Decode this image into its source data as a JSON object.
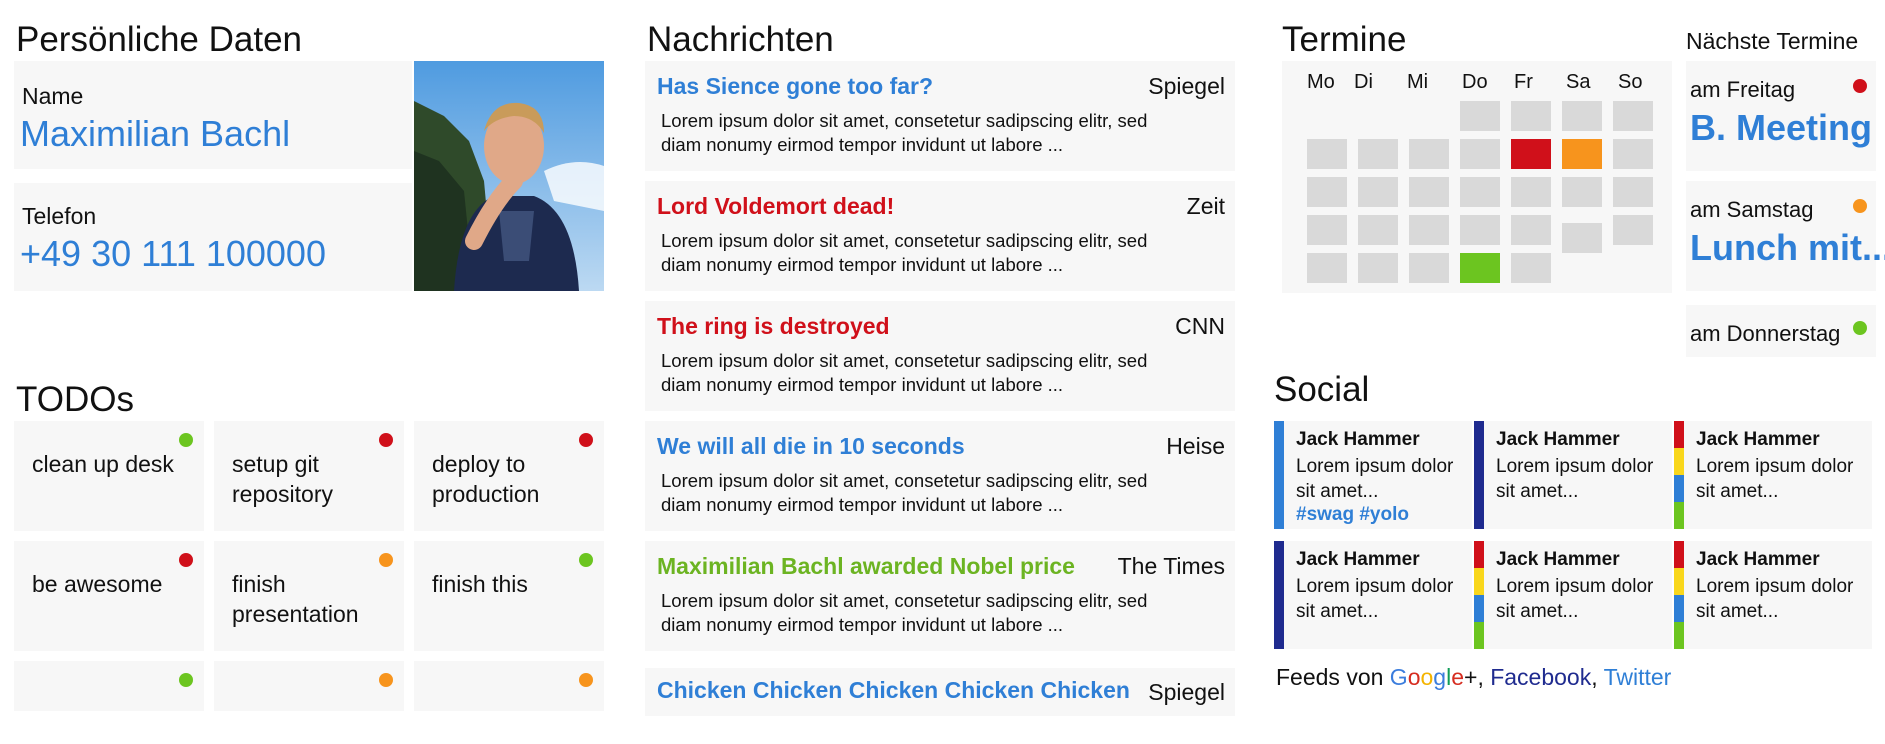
{
  "personal": {
    "title": "Persönliche Daten",
    "name_label": "Name",
    "name_value": "Maximilian Bachl",
    "phone_label": "Telefon",
    "phone_value": "+49 30 111 100000"
  },
  "todos": {
    "title": "TODOs",
    "items": [
      {
        "text": "clean up desk",
        "status": "green"
      },
      {
        "text": "setup git repository",
        "status": "red"
      },
      {
        "text": "deploy to production",
        "status": "red"
      },
      {
        "text": "be awesome",
        "status": "red"
      },
      {
        "text": "finish presentation",
        "status": "orange"
      },
      {
        "text": "finish this",
        "status": "green"
      },
      {
        "text": "",
        "status": "green"
      },
      {
        "text": "",
        "status": "orange"
      },
      {
        "text": "",
        "status": "orange"
      }
    ]
  },
  "news": {
    "title": "Nachrichten",
    "items": [
      {
        "headline": "Has Sience gone too far?",
        "source": "Spiegel",
        "body": "Lorem ipsum dolor sit amet, consetetur sadipscing elitr, sed diam nonumy eirmod tempor invidunt ut labore ...",
        "color": "#2f7fd6"
      },
      {
        "headline": "Lord Voldemort dead!",
        "source": "Zeit",
        "body": "Lorem ipsum dolor sit amet, consetetur sadipscing elitr, sed diam nonumy eirmod tempor invidunt ut labore ...",
        "color": "#d0101a"
      },
      {
        "headline": "The ring is destroyed",
        "source": "CNN",
        "body": "Lorem ipsum dolor sit amet, consetetur sadipscing elitr, sed diam nonumy eirmod tempor invidunt ut labore ...",
        "color": "#d0101a"
      },
      {
        "headline": "We will all die in 10 seconds",
        "source": "Heise",
        "body": "Lorem ipsum dolor sit amet, consetetur sadipscing elitr, sed diam nonumy eirmod tempor invidunt ut labore ...",
        "color": "#2f7fd6"
      },
      {
        "headline": "Maximilian Bachl awarded Nobel price",
        "source": "The Times",
        "body": "Lorem ipsum dolor sit amet, consetetur sadipscing elitr, sed diam nonumy eirmod tempor invidunt ut labore ...",
        "color": "#6cb422"
      },
      {
        "headline": "Chicken Chicken Chicken Chicken Chicken",
        "source": "Spiegel",
        "body": "",
        "color": "#2f7fd6"
      }
    ]
  },
  "calendar": {
    "title": "Termine",
    "days": [
      "Mo",
      "Di",
      "Mi",
      "Do",
      "Fr",
      "Sa",
      "So"
    ],
    "highlights": [
      {
        "row": 1,
        "col": 4,
        "color": "#d0101a"
      },
      {
        "row": 1,
        "col": 5,
        "color": "#f7941d"
      },
      {
        "row": 4,
        "col": 3,
        "color": "#6cc520"
      }
    ]
  },
  "upcoming": {
    "title": "Nächste Termine",
    "items": [
      {
        "label": "am Freitag",
        "title": "B. Meeting",
        "status": "red"
      },
      {
        "label": "am Samstag",
        "title": "Lunch mit...",
        "status": "orange"
      },
      {
        "label": "am Donnerstag",
        "title": "",
        "status": "green"
      }
    ]
  },
  "social": {
    "title": "Social",
    "posts": [
      {
        "author": "Jack Hammer",
        "text": "Lorem ipsum dolor sit amet...",
        "tags": "#swag #yolo",
        "network": "twitter"
      },
      {
        "author": "Jack Hammer",
        "text": "Lorem ipsum dolor sit amet...",
        "tags": "",
        "network": "facebook"
      },
      {
        "author": "Jack Hammer",
        "text": "Lorem ipsum dolor sit amet...",
        "tags": "",
        "network": "google"
      },
      {
        "author": "Jack Hammer",
        "text": "Lorem ipsum dolor sit amet...",
        "tags": "",
        "network": "facebook"
      },
      {
        "author": "Jack Hammer",
        "text": "Lorem ipsum dolor sit amet...",
        "tags": "",
        "network": "google"
      },
      {
        "author": "Jack Hammer",
        "text": "Lorem ipsum dolor sit amet...",
        "tags": "",
        "network": "google"
      }
    ],
    "feeds_prefix": "Feeds von ",
    "google_letters": [
      "G",
      "o",
      "o",
      "g",
      "l",
      "e",
      "+"
    ],
    "google_colors": [
      "#3b7ddd",
      "#d62d20",
      "#f4b400",
      "#3b7ddd",
      "#109d58",
      "#d62d20",
      "#111111"
    ],
    "sep": ", ",
    "facebook": "Facebook",
    "twitter": "Twitter"
  },
  "colors": {
    "accent_blue": "#2f7fd6",
    "green": "#6cc520",
    "red": "#d0101a",
    "orange": "#f7941d",
    "facebook_blue": "#1f2b8f",
    "twitter_blue": "#2f7fd6"
  }
}
